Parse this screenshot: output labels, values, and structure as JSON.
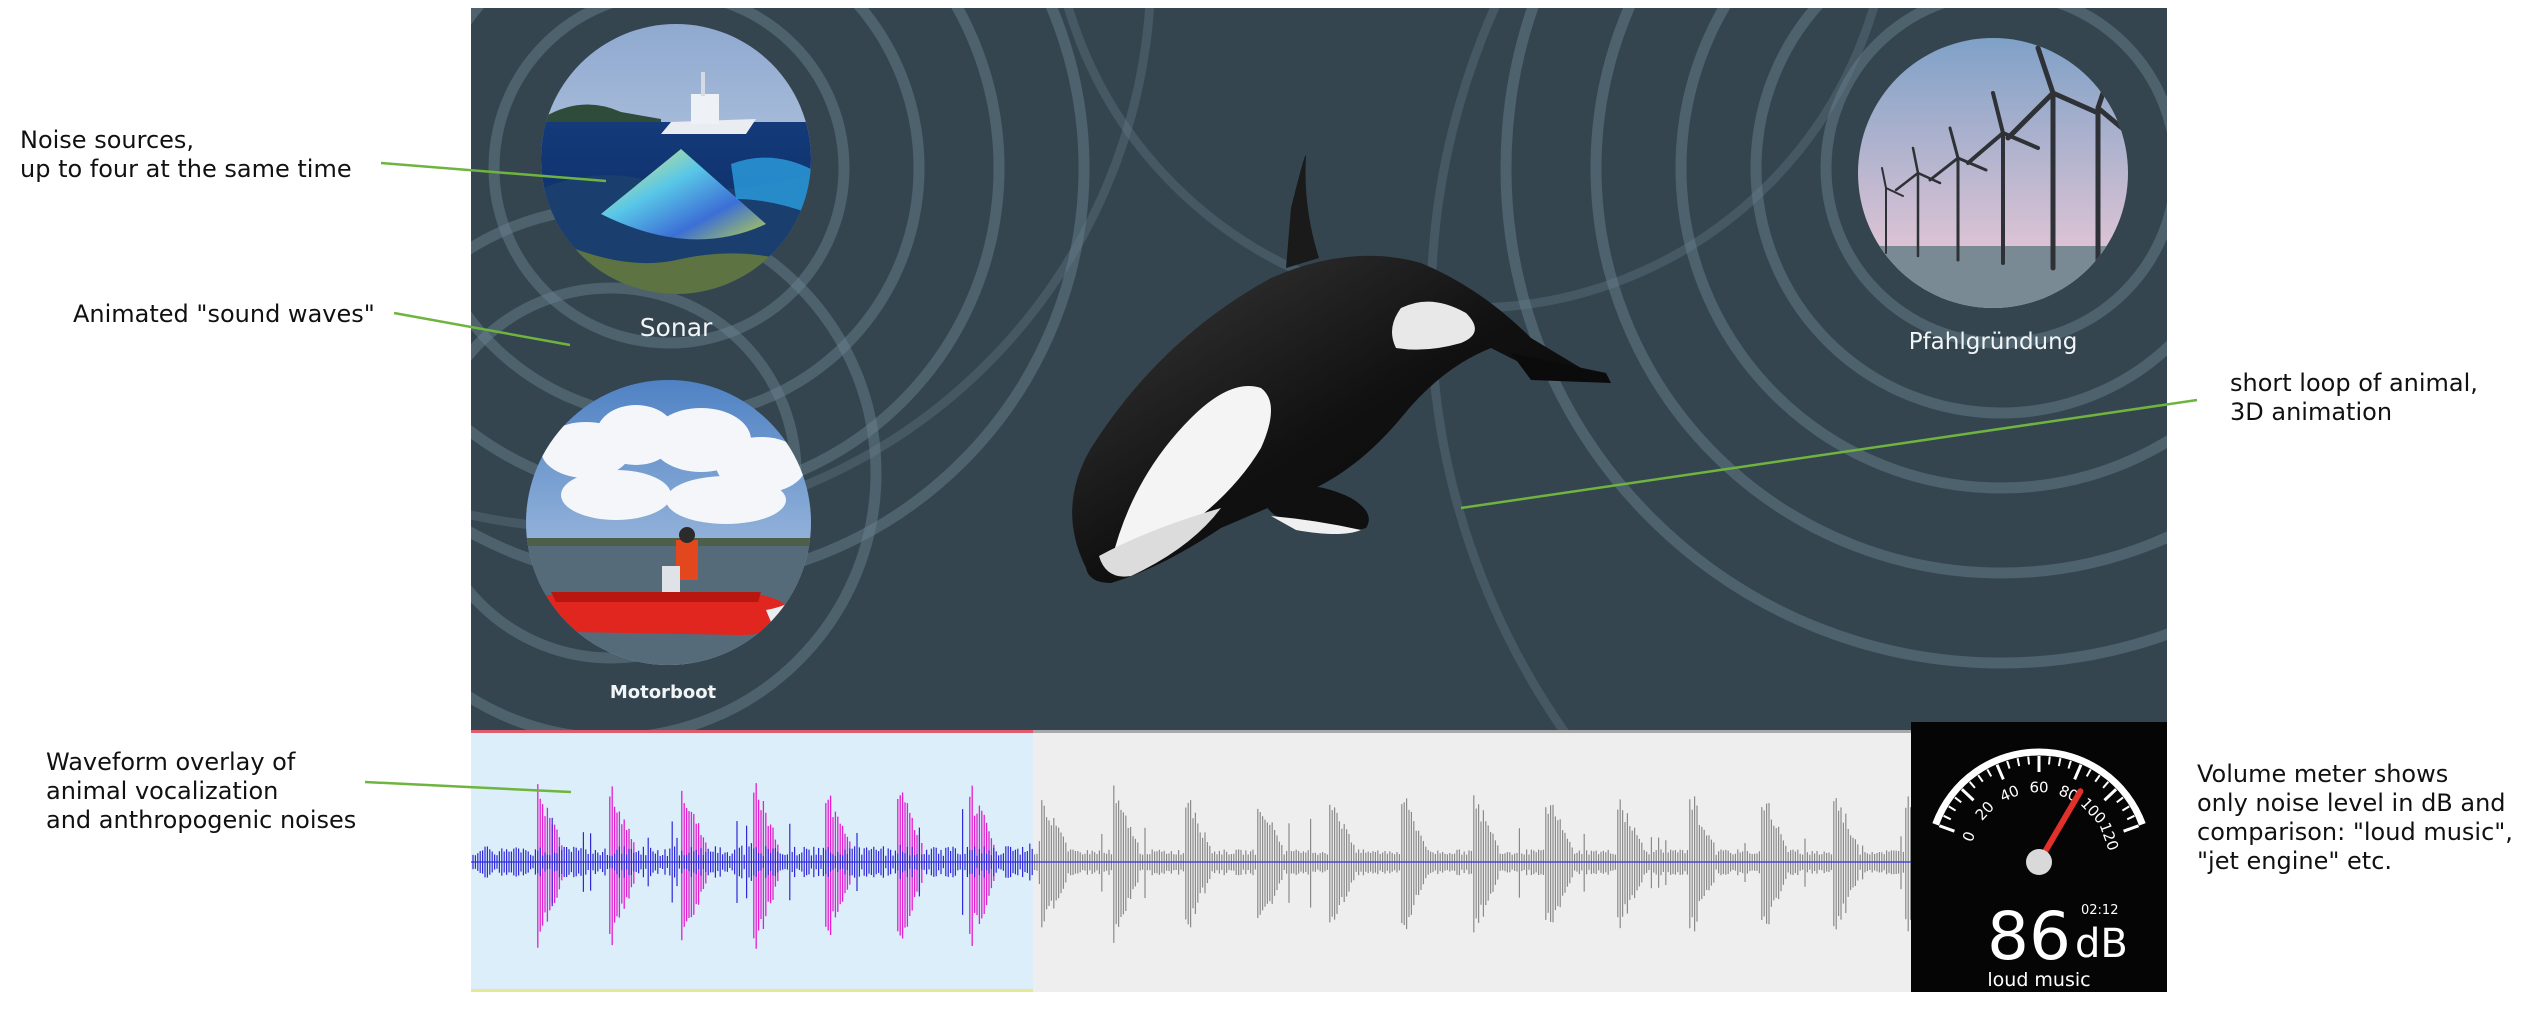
{
  "annotations": {
    "noise_sources": "Noise sources,\nup to four at the same time",
    "sound_waves": "Animated \"sound waves\"",
    "waveform_overlay": "Waveform overlay of\nanimal vocalization\nand anthropogenic noises",
    "animal_loop": "short loop of animal,\n3D animation",
    "volume_meter": "Volume meter shows\nonly noise level in dB and\ncomparison: \"loud music\",\n\"jet engine\" etc."
  },
  "noise_sources": [
    {
      "label": "Sonar",
      "icon": "sonar-ship-icon"
    },
    {
      "label": "Motorboot",
      "icon": "motorboat-icon"
    },
    {
      "label": "Pfahlgründung",
      "icon": "wind-turbines-icon"
    }
  ],
  "animal": {
    "icon": "orca-icon"
  },
  "waveform": {
    "progress": 0.39,
    "colors": {
      "played_bg": "#dbeefa",
      "unplayed_bg": "#eeeeee",
      "animal": "#e21fd0",
      "noise": "#2d28d8",
      "unplayed": "#8a8a8a",
      "top_line": "#e05c6c"
    }
  },
  "meter": {
    "value": "86",
    "unit": "dB",
    "time": "02:12",
    "comparison": "loud music",
    "ticks": [
      "0",
      "20",
      "40",
      "60",
      "80",
      "100",
      "120"
    ],
    "needle_value": 86,
    "needle_color": "#e2302a"
  },
  "colors": {
    "stage_bg": "#34454f",
    "wave_rings": "#6c8592",
    "callout_line": "#6fb43f"
  }
}
